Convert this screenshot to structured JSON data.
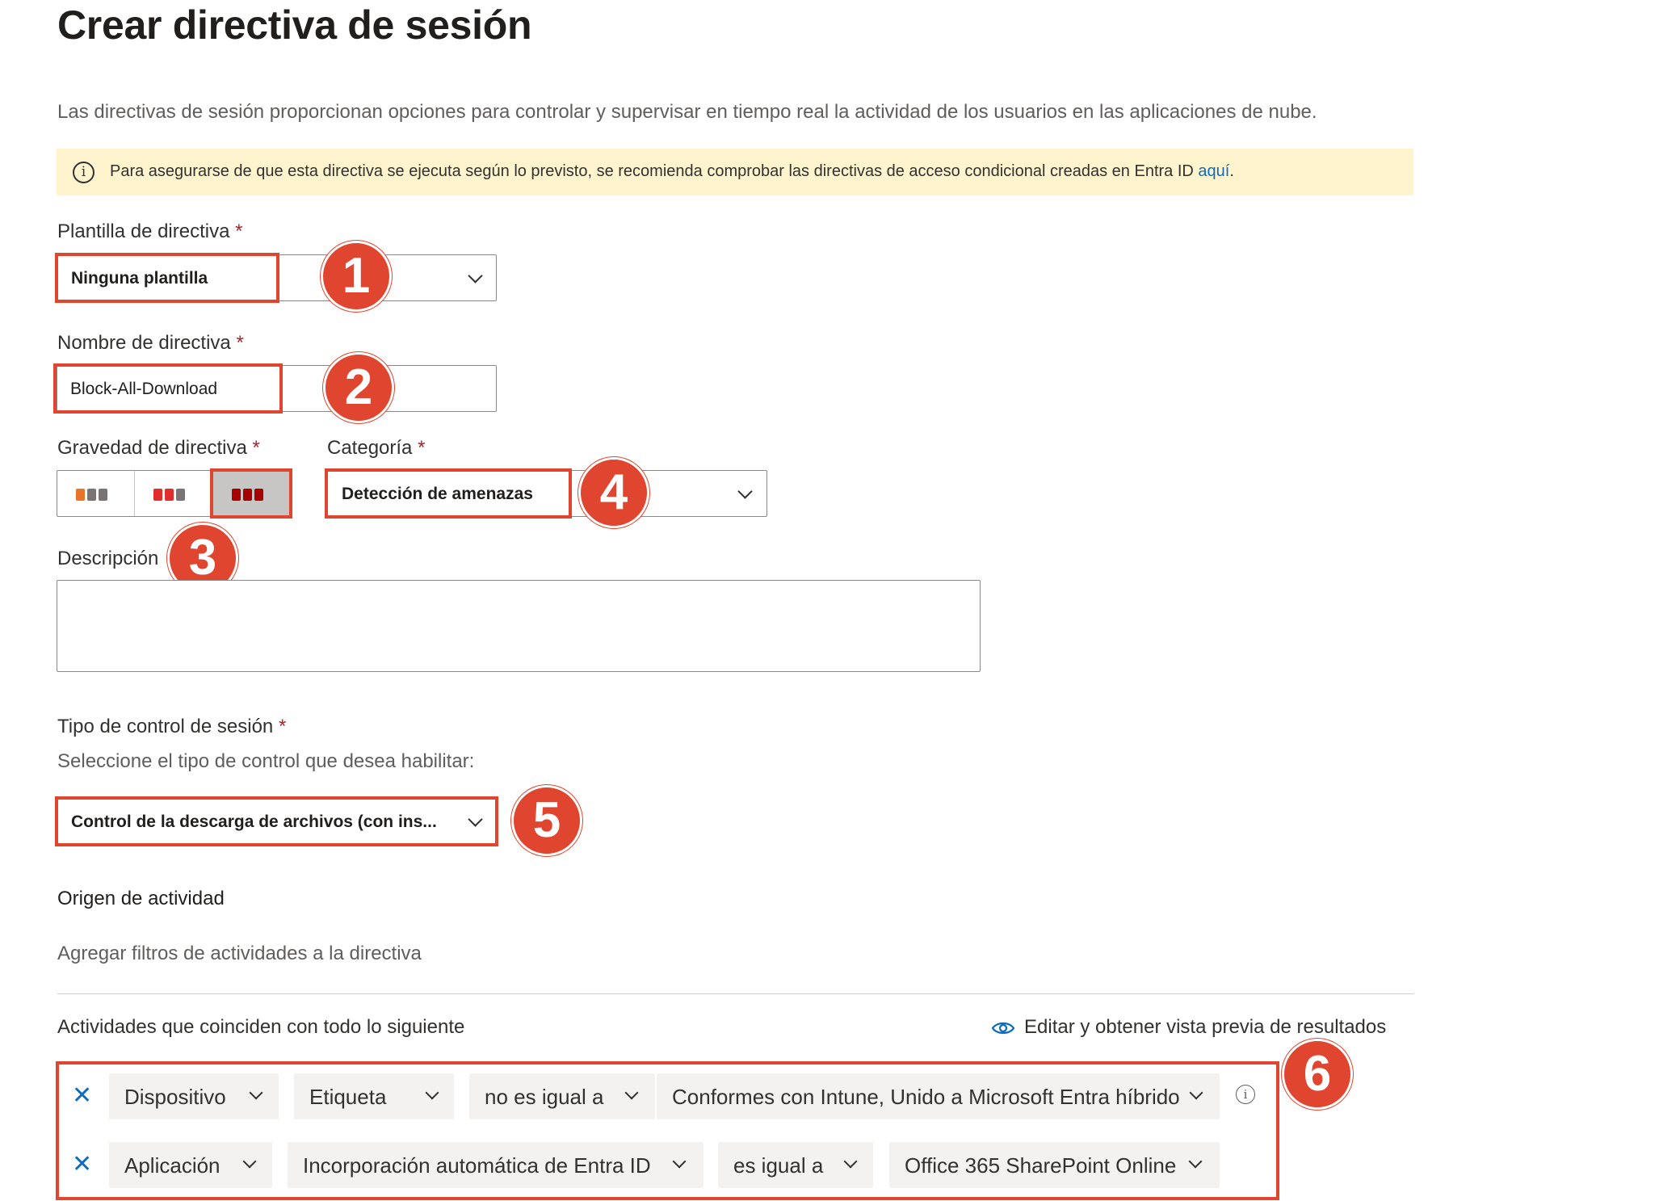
{
  "page": {
    "title": "Crear directiva de sesión",
    "description": "Las directivas de sesión proporcionan opciones para controlar y supervisar en tiempo real la actividad de los usuarios en las aplicaciones de nube."
  },
  "banner": {
    "icon": "info-icon",
    "text": "Para asegurarse de que esta directiva se ejecuta según lo previsto, se recomienda comprobar las directivas de acceso condicional creadas en Entra ID ",
    "link_text": "aquí",
    "link_suffix": "."
  },
  "template": {
    "label": "Plantilla de directiva",
    "required_mark": "*",
    "value": "Ninguna plantilla"
  },
  "policy_name": {
    "label": "Nombre de directiva",
    "required_mark": "*",
    "value": "Block-All-Download"
  },
  "severity": {
    "label": "Gravedad de directiva",
    "required_mark": "*",
    "options": [
      "low",
      "medium",
      "high"
    ],
    "selected": "high",
    "colors": {
      "low": "#e8742a",
      "medium": "#e02d2d",
      "high": "#a80000",
      "inactive": "#7a7574"
    }
  },
  "category": {
    "label": "Categoría",
    "required_mark": "*",
    "value": "Detección de amenazas"
  },
  "description_field": {
    "label": "Descripción",
    "value": ""
  },
  "session_control": {
    "label": "Tipo de control de sesión",
    "required_mark": "*",
    "help": "Seleccione el tipo de control que desea habilitar:",
    "value": "Control de la descarga de archivos (con ins..."
  },
  "activity_source": {
    "heading": "Origen de actividad",
    "filters_placeholder": "Agregar filtros de actividades a la directiva"
  },
  "activities": {
    "heading": "Actividades que coinciden con todo lo siguiente",
    "preview_link": "Editar y obtener vista previa de resultados",
    "rows": [
      {
        "field": "Dispositivo",
        "subfield": "Etiqueta",
        "operator": "no es igual a",
        "value": "Conformes con Intune, Unido a Microsoft Entra híbrido"
      },
      {
        "field": "Aplicación",
        "subfield": "Incorporación automática de Entra ID",
        "operator": "es igual a",
        "value": "Office 365 SharePoint Online"
      }
    ]
  },
  "annotations": {
    "badges": [
      "1",
      "2",
      "3",
      "4",
      "5",
      "6"
    ],
    "color": "#e0452f"
  }
}
